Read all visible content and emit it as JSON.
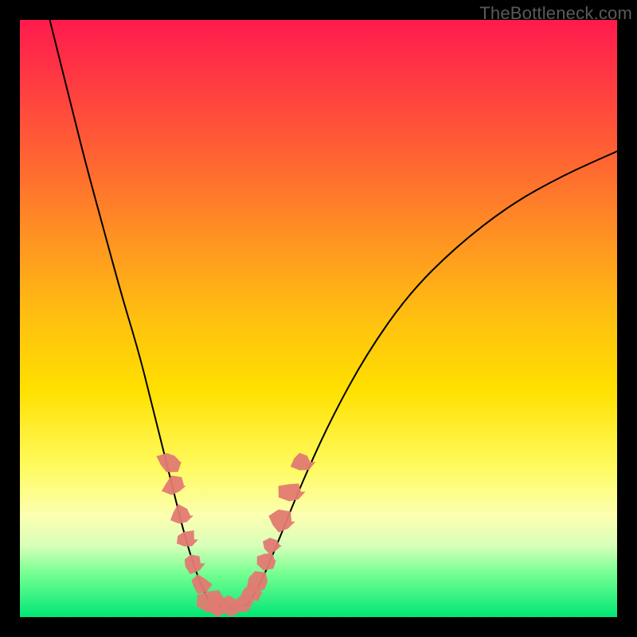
{
  "watermark": "TheBottleneck.com",
  "chart_data": {
    "type": "line",
    "title": "",
    "xlabel": "",
    "ylabel": "",
    "xlim": [
      0,
      100
    ],
    "ylim": [
      0,
      100
    ],
    "grid": false,
    "legend": false,
    "background_gradient": {
      "top": "#ff1a4d",
      "mid": "#ffe000",
      "bottom": "#00e676"
    },
    "series": [
      {
        "name": "left-branch",
        "x": [
          5,
          8,
          11,
          14,
          17,
          20,
          22,
          24,
          26,
          27.5,
          29,
          30.5,
          32
        ],
        "y": [
          100,
          88,
          76,
          65,
          54,
          44,
          36,
          28,
          20,
          14,
          9,
          5,
          2
        ]
      },
      {
        "name": "floor",
        "x": [
          32,
          34,
          36,
          38
        ],
        "y": [
          2,
          1.5,
          1.5,
          2
        ]
      },
      {
        "name": "right-branch",
        "x": [
          38,
          40,
          43,
          47,
          52,
          58,
          65,
          73,
          82,
          91,
          100
        ],
        "y": [
          2,
          5,
          12,
          22,
          33,
          44,
          54,
          62,
          69,
          74,
          78
        ]
      }
    ],
    "markers": {
      "name": "data-splats",
      "color": "#e27a72",
      "points": [
        {
          "x": 25.0,
          "y": 26
        },
        {
          "x": 25.8,
          "y": 22
        },
        {
          "x": 27.0,
          "y": 17
        },
        {
          "x": 27.8,
          "y": 13
        },
        {
          "x": 29.0,
          "y": 9
        },
        {
          "x": 30.2,
          "y": 5.5
        },
        {
          "x": 31.8,
          "y": 2.8
        },
        {
          "x": 33.5,
          "y": 1.8
        },
        {
          "x": 35.5,
          "y": 1.7
        },
        {
          "x": 37.2,
          "y": 2.2
        },
        {
          "x": 38.8,
          "y": 4
        },
        {
          "x": 39.8,
          "y": 6
        },
        {
          "x": 41.2,
          "y": 9.5
        },
        {
          "x": 42.2,
          "y": 12
        },
        {
          "x": 43.8,
          "y": 16
        },
        {
          "x": 45.5,
          "y": 21
        },
        {
          "x": 47.2,
          "y": 26
        }
      ]
    }
  }
}
